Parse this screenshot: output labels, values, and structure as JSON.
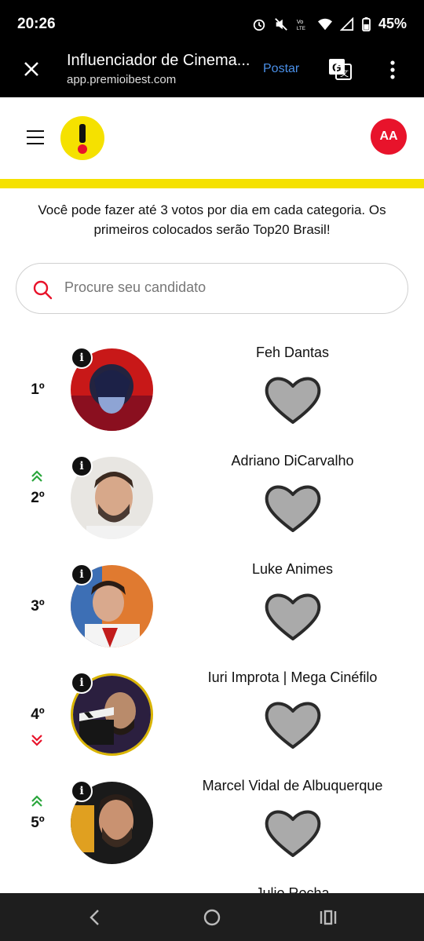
{
  "status_bar": {
    "time": "20:26",
    "battery": "45%",
    "icons": [
      "alarm-icon",
      "mute-icon",
      "volte-icon",
      "wifi-icon",
      "signal-icon",
      "battery-icon"
    ]
  },
  "browser": {
    "title": "Influenciador de Cinema...",
    "url": "app.premioibest.com",
    "action_label": "Postar"
  },
  "header": {
    "avatar_initials": "AA",
    "accent_color": "#f5e100",
    "brand_red": "#e8132b"
  },
  "intro_text": "Você pode fazer até 3 votos por dia em cada categoria. Os primeiros colocados serão Top20 Brasil!",
  "search": {
    "placeholder": "Procure seu candidato"
  },
  "candidates": [
    {
      "rank": "1º",
      "name": "Feh Dantas",
      "trend": "none"
    },
    {
      "rank": "2º",
      "name": "Adriano DiCarvalho",
      "trend": "up"
    },
    {
      "rank": "3º",
      "name": "Luke Animes",
      "trend": "none"
    },
    {
      "rank": "4º",
      "name": "Iuri Improta | Mega Cinéfilo",
      "trend": "down"
    },
    {
      "rank": "5º",
      "name": "Marcel Vidal de Albuquerque",
      "trend": "up"
    },
    {
      "rank": "",
      "name": "Julio Rocha",
      "trend": "none"
    }
  ],
  "info_badge": "i"
}
